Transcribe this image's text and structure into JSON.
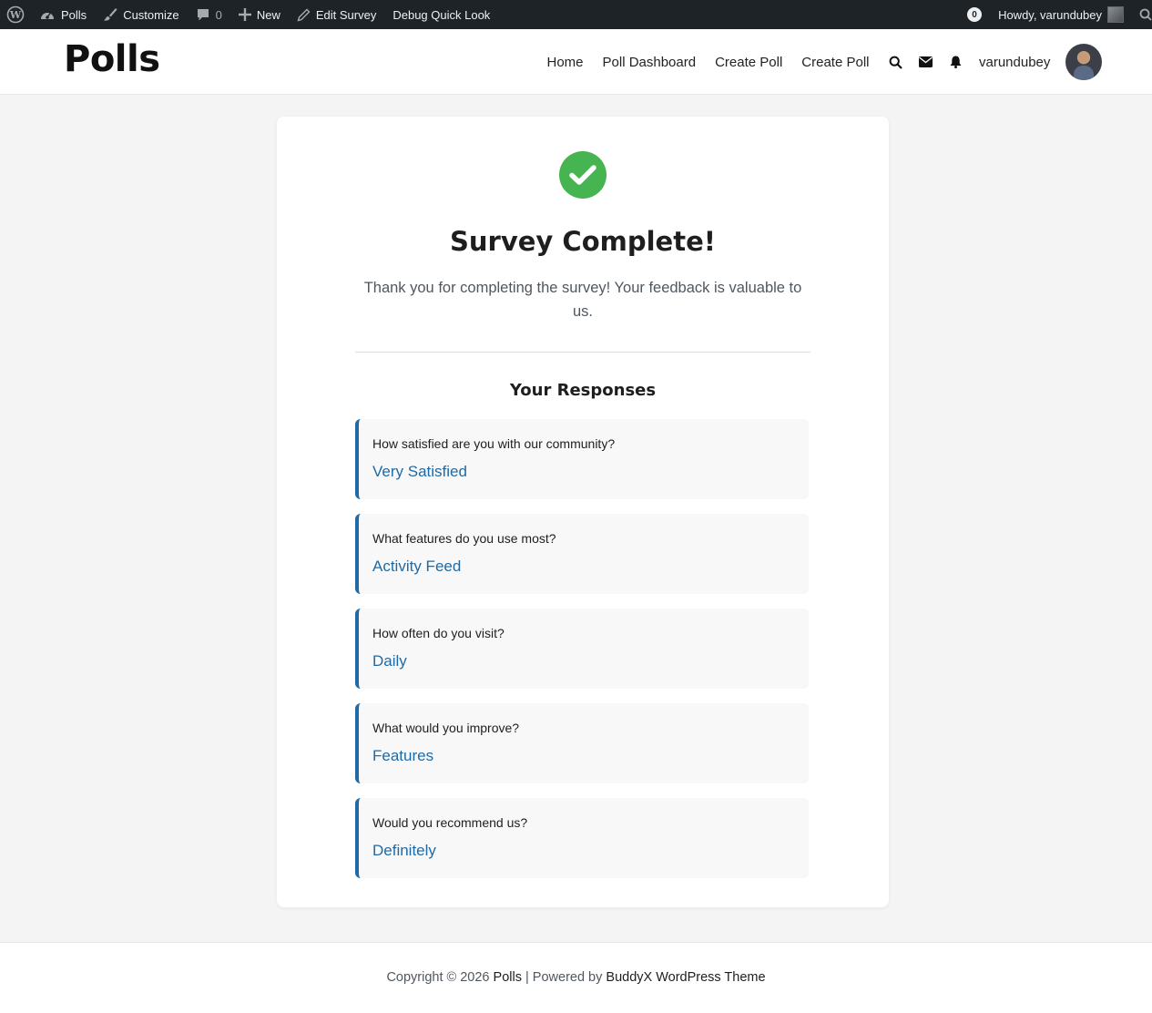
{
  "admin_bar": {
    "site_name": "Polls",
    "customize": "Customize",
    "comments_count": "0",
    "new": "New",
    "edit_survey": "Edit Survey",
    "debug": "Debug Quick Look",
    "notif_count": "0",
    "howdy": "Howdy, varundubey"
  },
  "header": {
    "site_title": "Polls",
    "nav": [
      "Home",
      "Poll Dashboard",
      "Create Poll",
      "Create Poll"
    ],
    "username": "varundubey"
  },
  "card": {
    "title": "Survey Complete!",
    "message": "Thank you for completing the survey! Your feedback is valuable to us.",
    "responses_heading": "Your Responses",
    "responses": [
      {
        "question": "How satisfied are you with our community?",
        "answer": "Very Satisfied"
      },
      {
        "question": "What features do you use most?",
        "answer": "Activity Feed"
      },
      {
        "question": "How often do you visit?",
        "answer": "Daily"
      },
      {
        "question": "What would you improve?",
        "answer": "Features"
      },
      {
        "question": "Would you recommend us?",
        "answer": "Definitely"
      }
    ]
  },
  "footer": {
    "prefix": "Copyright © 2026",
    "site": "Polls",
    "separator": "| Powered by",
    "theme": "BuddyX WordPress Theme"
  },
  "colors": {
    "admin_bar_bg": "#1d2327",
    "success_green": "#46b450",
    "accent_blue": "#1f6aa5",
    "page_bg": "#f4f4f5"
  }
}
